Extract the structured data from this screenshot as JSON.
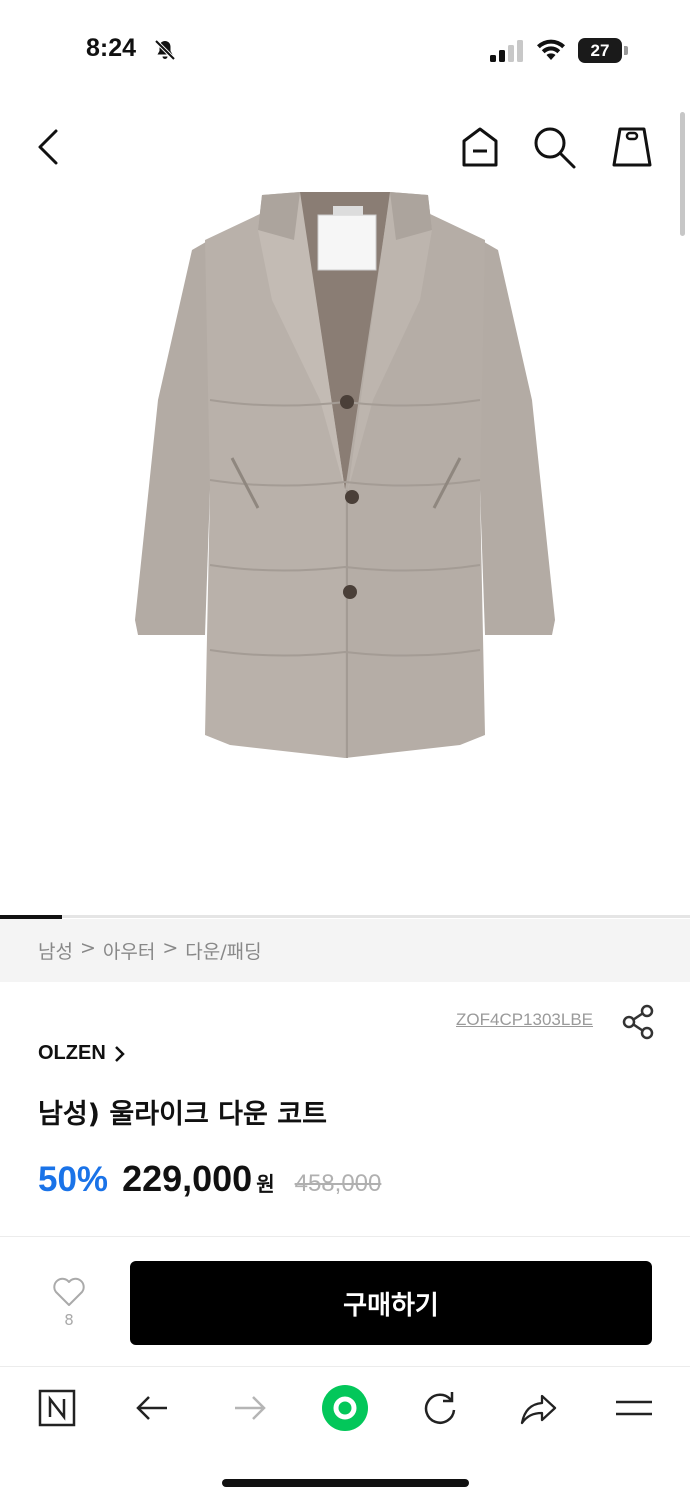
{
  "status_bar": {
    "time": "8:24",
    "battery": "27"
  },
  "header": {
    "icons": [
      "back-arrow-icon",
      "home-icon",
      "search-icon",
      "cart-icon"
    ]
  },
  "breadcrumb": {
    "items": [
      "남성",
      "아우터",
      "다운/패딩"
    ],
    "separator": ">"
  },
  "product": {
    "sku": "ZOF4CP1303LBE",
    "brand": "OLZEN",
    "name": "남성) 울라이크 다운 코트",
    "discount": "50%",
    "price": "229,000",
    "currency": "원",
    "original_price": "458,000",
    "image_index_progress": 0.09
  },
  "purchase_bar": {
    "wish_count": "8",
    "buy_label": "구매하기"
  },
  "colors": {
    "accent_blue": "#1a73e8",
    "naver_green": "#03c75a",
    "buy_button_bg": "#000000"
  }
}
